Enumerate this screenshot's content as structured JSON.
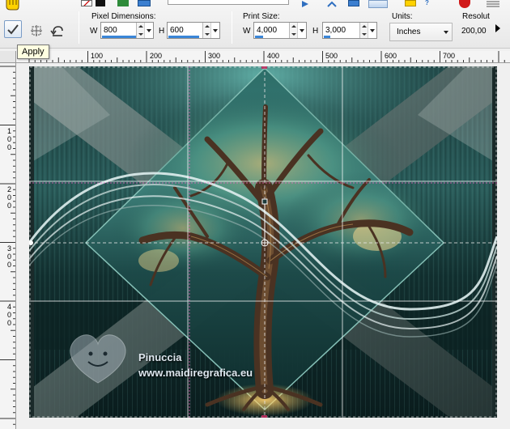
{
  "toolbar": {
    "pixel_dimensions_label": "Pixel Dimensions:",
    "pixel_w_label": "W",
    "pixel_w_value": "800",
    "pixel_h_label": "H",
    "pixel_h_value": "600",
    "print_size_label": "Print Size:",
    "print_w_label": "W",
    "print_w_value": "4,000",
    "print_h_label": "H",
    "print_h_value": "3,000",
    "units_label": "Units:",
    "units_value": "Inches",
    "resolution_label": "Resolut",
    "resolution_value": "200,00"
  },
  "tooltip": {
    "text": "Apply"
  },
  "rulers": {
    "top": [
      "100",
      "200",
      "300",
      "400",
      "500",
      "600",
      "700"
    ],
    "left": [
      "100",
      "200",
      "300",
      "400"
    ]
  },
  "watermark": {
    "name": "Pinuccia",
    "url": "www.maidiregrafica.eu"
  },
  "icons": {
    "apply": "checkmark-icon",
    "resize_mode": "resize-grid-icon",
    "reset": "undo-arrow-icon"
  }
}
